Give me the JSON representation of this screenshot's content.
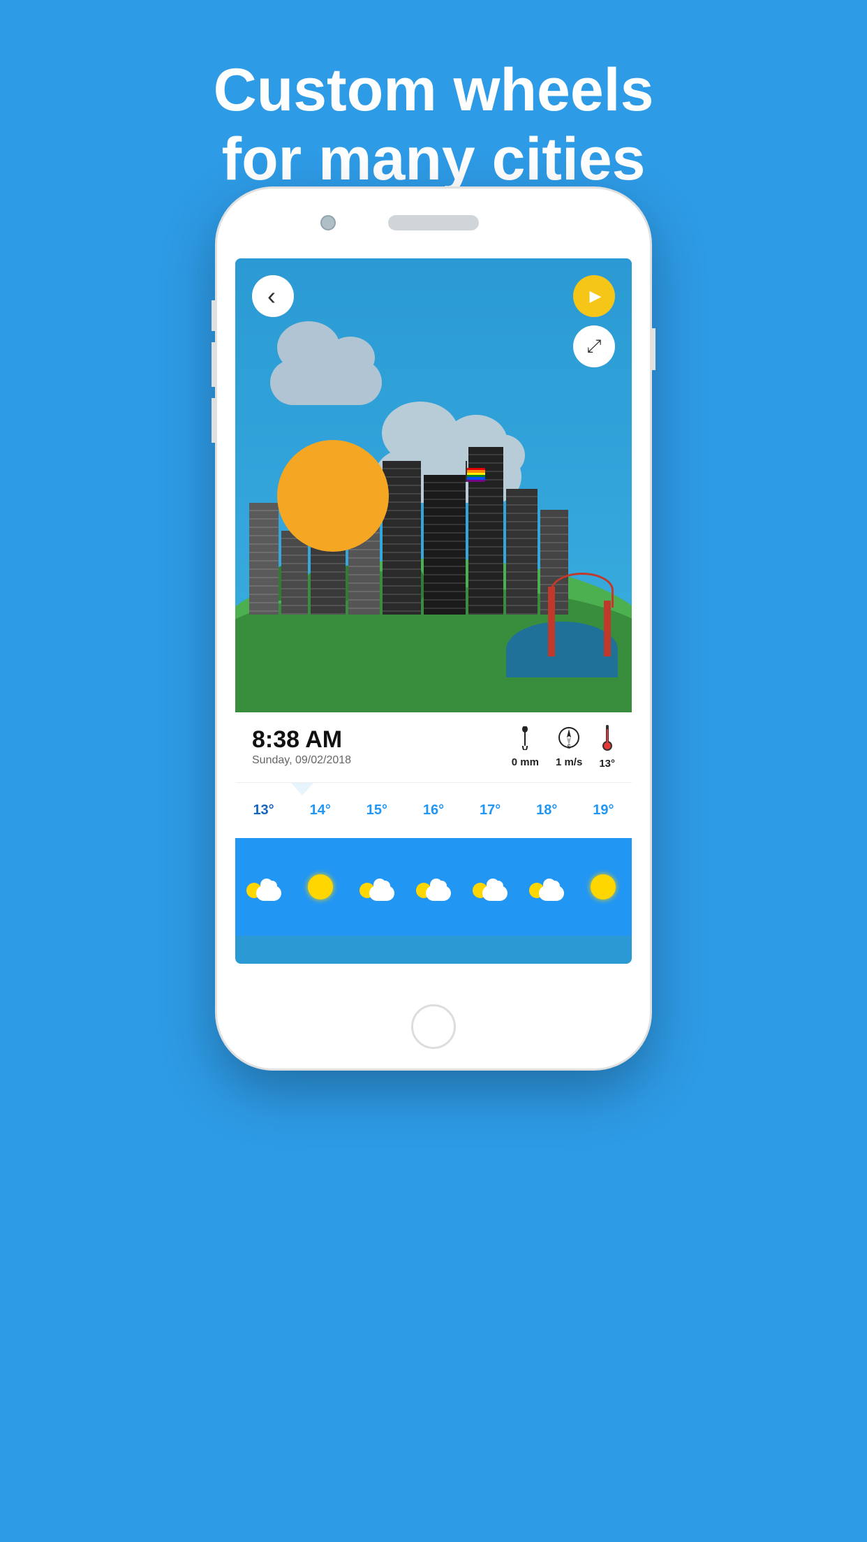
{
  "header": {
    "line1": "Custom wheels",
    "line2": "for many cities"
  },
  "weather": {
    "time": "8:38 AM",
    "date": "Sunday, 09/02/2018",
    "rain": "0 mm",
    "wind": "1 m/s",
    "temp_current": "13°",
    "temperatures": [
      "13°",
      "14°",
      "15°",
      "16°",
      "17°",
      "18°",
      "19°"
    ],
    "rain_icon": "💧",
    "wind_icon": "🧭",
    "thermo_icon": "🌡"
  },
  "buttons": {
    "back": "‹",
    "play": "▶",
    "expand": "⤢"
  }
}
